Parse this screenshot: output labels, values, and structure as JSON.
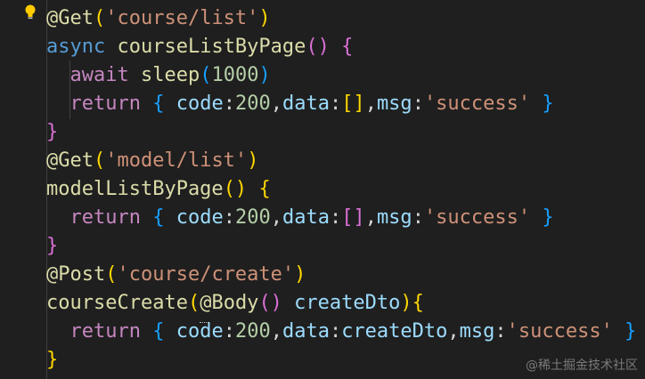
{
  "editor": {
    "lines": [
      [
        {
          "t": "@Get",
          "c": "dec"
        },
        {
          "t": "(",
          "c": "br1"
        },
        {
          "t": "'course/list'",
          "c": "str"
        },
        {
          "t": ")",
          "c": "br1"
        }
      ],
      [
        {
          "t": "async ",
          "c": "kw"
        },
        {
          "t": "courseListByPage",
          "c": "fn"
        },
        {
          "t": "()",
          "c": "br2"
        },
        {
          "t": " ",
          "c": "pun"
        },
        {
          "t": "{",
          "c": "br2"
        }
      ],
      [
        {
          "t": "  await ",
          "c": "ctl"
        },
        {
          "t": "sleep",
          "c": "fn"
        },
        {
          "t": "(",
          "c": "br3"
        },
        {
          "t": "1000",
          "c": "num"
        },
        {
          "t": ")",
          "c": "br3"
        }
      ],
      [
        {
          "t": "  return ",
          "c": "ctl"
        },
        {
          "t": "{",
          "c": "br3"
        },
        {
          "t": " code",
          "c": "prop"
        },
        {
          "t": ":",
          "c": "pun"
        },
        {
          "t": "200",
          "c": "num"
        },
        {
          "t": ",",
          "c": "pun"
        },
        {
          "t": "data",
          "c": "prop"
        },
        {
          "t": ":",
          "c": "pun"
        },
        {
          "t": "[]",
          "c": "br1"
        },
        {
          "t": ",",
          "c": "pun"
        },
        {
          "t": "msg",
          "c": "prop"
        },
        {
          "t": ":",
          "c": "pun"
        },
        {
          "t": "'success'",
          "c": "str"
        },
        {
          "t": " ",
          "c": "pun"
        },
        {
          "t": "}",
          "c": "br3"
        }
      ],
      [
        {
          "t": "}",
          "c": "br2"
        }
      ],
      [
        {
          "t": "@Get",
          "c": "dec"
        },
        {
          "t": "(",
          "c": "br1"
        },
        {
          "t": "'model/list'",
          "c": "str"
        },
        {
          "t": ")",
          "c": "br1"
        }
      ],
      [
        {
          "t": "modelListByPage",
          "c": "fn"
        },
        {
          "t": "()",
          "c": "br1"
        },
        {
          "t": " ",
          "c": "pun"
        },
        {
          "t": "{",
          "c": "br1"
        }
      ],
      [
        {
          "t": "  return ",
          "c": "ctl"
        },
        {
          "t": "{",
          "c": "br3"
        },
        {
          "t": " code",
          "c": "prop"
        },
        {
          "t": ":",
          "c": "pun"
        },
        {
          "t": "200",
          "c": "num"
        },
        {
          "t": ",",
          "c": "pun"
        },
        {
          "t": "data",
          "c": "prop"
        },
        {
          "t": ":",
          "c": "pun"
        },
        {
          "t": "[]",
          "c": "br2"
        },
        {
          "t": ",",
          "c": "pun"
        },
        {
          "t": "msg",
          "c": "prop"
        },
        {
          "t": ":",
          "c": "pun"
        },
        {
          "t": "'success'",
          "c": "str"
        },
        {
          "t": " ",
          "c": "pun"
        },
        {
          "t": "}",
          "c": "br3"
        }
      ],
      [
        {
          "t": "}",
          "c": "br2"
        }
      ],
      [
        {
          "t": "@Post",
          "c": "dec"
        },
        {
          "t": "(",
          "c": "br1"
        },
        {
          "t": "'course/create'",
          "c": "str"
        },
        {
          "t": ")",
          "c": "br1"
        }
      ],
      [
        {
          "t": "courseCreate",
          "c": "fn"
        },
        {
          "t": "(",
          "c": "br1"
        },
        {
          "t": "@Body",
          "c": "dec"
        },
        {
          "t": "()",
          "c": "br2"
        },
        {
          "t": " createDto",
          "c": "var"
        },
        {
          "t": ")",
          "c": "br1"
        },
        {
          "t": "{",
          "c": "br1"
        }
      ],
      [
        {
          "t": "  return ",
          "c": "ctl"
        },
        {
          "t": "{",
          "c": "br3"
        },
        {
          "t": " code",
          "c": "prop"
        },
        {
          "t": ":",
          "c": "pun"
        },
        {
          "t": "200",
          "c": "num"
        },
        {
          "t": ",",
          "c": "pun"
        },
        {
          "t": "data",
          "c": "prop"
        },
        {
          "t": ":",
          "c": "pun"
        },
        {
          "t": "createDto",
          "c": "var"
        },
        {
          "t": ",",
          "c": "pun"
        },
        {
          "t": "msg",
          "c": "prop"
        },
        {
          "t": ":",
          "c": "pun"
        },
        {
          "t": "'success'",
          "c": "str"
        },
        {
          "t": " ",
          "c": "pun"
        },
        {
          "t": "}",
          "c": "br3"
        }
      ],
      [
        {
          "t": "}",
          "c": "br1"
        }
      ]
    ],
    "lightbulb_icon": "lightbulb-icon",
    "colors": {
      "background": "#1f1f1f",
      "decorator": "#dcdcaa",
      "string": "#ce9178",
      "keyword": "#569cd6",
      "control": "#c586c0",
      "number": "#b5cea8",
      "property": "#9cdcfe"
    }
  },
  "watermark": {
    "text": "@稀土掘金技术社区"
  }
}
